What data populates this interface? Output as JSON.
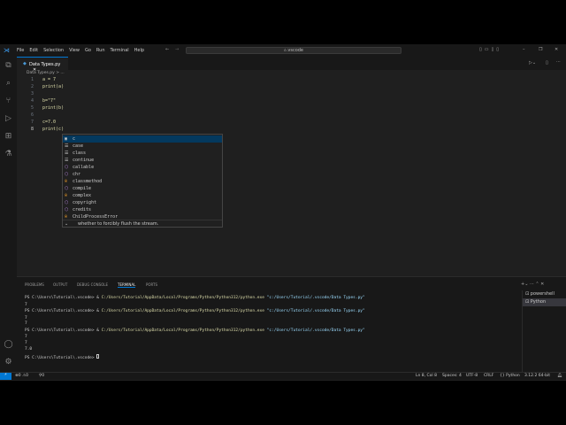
{
  "title_bar": {
    "menus": [
      "File",
      "Edit",
      "Selection",
      "View",
      "Go",
      "Run",
      "Terminal",
      "Help"
    ],
    "search": ".vscode"
  },
  "tab": {
    "label": "Data Types.py"
  },
  "breadcrumb": "Data Types.py > ...",
  "code": [
    {
      "n": "1",
      "t": "a = 7"
    },
    {
      "n": "2",
      "t": "print(a)"
    },
    {
      "n": "3",
      "t": ""
    },
    {
      "n": "4",
      "t": "b=\"7\""
    },
    {
      "n": "5",
      "t": "print(b)"
    },
    {
      "n": "6",
      "t": ""
    },
    {
      "n": "7",
      "t": "c=7.0"
    },
    {
      "n": "8",
      "t": "print(c)"
    }
  ],
  "suggestions": [
    {
      "icon": "variable",
      "label": "c"
    },
    {
      "icon": "keyword",
      "label": "case"
    },
    {
      "icon": "keyword",
      "label": "class"
    },
    {
      "icon": "keyword",
      "label": "continue"
    },
    {
      "icon": "function",
      "label": "callable"
    },
    {
      "icon": "function",
      "label": "chr"
    },
    {
      "icon": "class",
      "label": "classmethod"
    },
    {
      "icon": "function",
      "label": "compile"
    },
    {
      "icon": "class",
      "label": "complex"
    },
    {
      "icon": "function",
      "label": "copyright"
    },
    {
      "icon": "function",
      "label": "credits"
    },
    {
      "icon": "class",
      "label": "ChildProcessError"
    }
  ],
  "suggest_detail": "whether to forcibly flush the stream.",
  "panel": {
    "tabs": [
      "PROBLEMS",
      "OUTPUT",
      "DEBUG CONSOLE",
      "TERMINAL",
      "PORTS"
    ],
    "active": "TERMINAL",
    "terminal": [
      {
        "p": "PS C:\\Users\\Tutorial\\.vscode> & ",
        "c": "C:/Users/Tutorial/AppData/Local/Programs/Python/Python312/python.exe",
        "a": " \"c:/Users/Tutorial/.vscode/Data Types.py\""
      },
      {
        "p": "7"
      },
      {
        "p": "PS C:\\Users\\Tutorial\\.vscode> & ",
        "c": "C:/Users/Tutorial/AppData/Local/Programs/Python/Python312/python.exe",
        "a": " \"c:/Users/Tutorial/.vscode/Data Types.py\""
      },
      {
        "p": "7"
      },
      {
        "p": "7"
      },
      {
        "p": "PS C:\\Users\\Tutorial\\.vscode> & ",
        "c": "C:/Users/Tutorial/AppData/Local/Programs/Python/Python312/python.exe",
        "a": " \"c:/Users/Tutorial/.vscode/Data Types.py\""
      },
      {
        "p": "7"
      },
      {
        "p": "7"
      },
      {
        "p": "7.0"
      },
      {
        "p": "PS C:\\Users\\Tutorial\\.vscode> "
      }
    ],
    "terminals": [
      "powershell",
      "Python"
    ]
  },
  "status": {
    "errors": "0",
    "warnings": "0",
    "ports": "0",
    "position": "Ln 8, Col 8",
    "spaces": "Spaces: 4",
    "encoding": "UTF-8",
    "eol": "CRLF",
    "language": "Python",
    "interpreter": "3.12.2 64-bit"
  }
}
